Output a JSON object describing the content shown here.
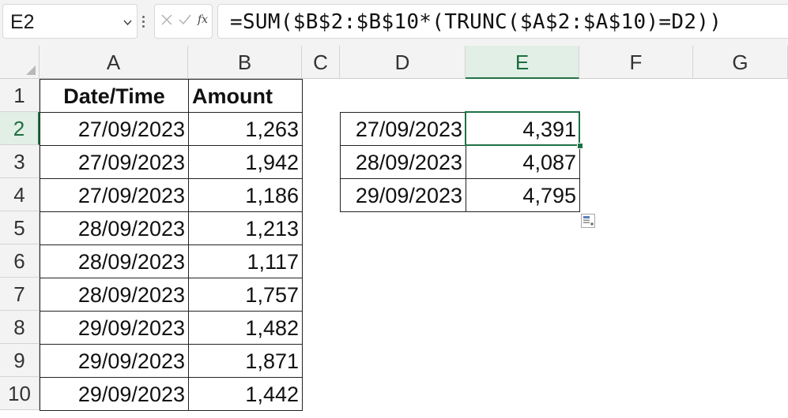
{
  "name_box": {
    "value": "E2"
  },
  "formula_bar": {
    "formula": "=SUM($B$2:$B$10*(TRUNC($A$2:$A$10)=D2))",
    "fx_label": "fx"
  },
  "columns": [
    "A",
    "B",
    "C",
    "D",
    "E",
    "F",
    "G"
  ],
  "rows": [
    "1",
    "2",
    "3",
    "4",
    "5",
    "6",
    "7",
    "8",
    "9",
    "10"
  ],
  "selected_cell": "E2",
  "table_main": {
    "headers": {
      "a": "Date/Time",
      "b": "Amount"
    },
    "rows": [
      {
        "a": "27/09/2023",
        "b": "1,263"
      },
      {
        "a": "27/09/2023",
        "b": "1,942"
      },
      {
        "a": "27/09/2023",
        "b": "1,186"
      },
      {
        "a": "28/09/2023",
        "b": "1,213"
      },
      {
        "a": "28/09/2023",
        "b": "1,117"
      },
      {
        "a": "28/09/2023",
        "b": "1,757"
      },
      {
        "a": "29/09/2023",
        "b": "1,482"
      },
      {
        "a": "29/09/2023",
        "b": "1,871"
      },
      {
        "a": "29/09/2023",
        "b": "1,442"
      }
    ]
  },
  "table_summary": {
    "rows": [
      {
        "d": "27/09/2023",
        "e": "4,391"
      },
      {
        "d": "28/09/2023",
        "e": "4,087"
      },
      {
        "d": "29/09/2023",
        "e": "4,795"
      }
    ]
  },
  "colors": {
    "accent": "#217346",
    "header_bg": "#f3f3f3",
    "selected_header_bg": "#e1efe6"
  },
  "icons": [
    "chevron-down-icon",
    "more-options-icon",
    "cancel-icon",
    "enter-icon",
    "insert-function-icon",
    "quick-analysis-icon"
  ]
}
